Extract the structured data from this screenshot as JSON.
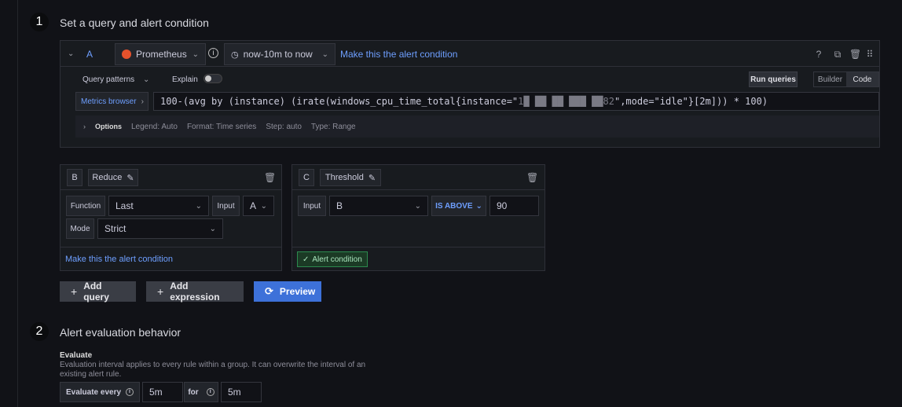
{
  "step1": {
    "number": "1",
    "title": "Set a query and alert condition"
  },
  "query_a": {
    "ref": "A",
    "datasource": "Prometheus",
    "time_range": "now-10m to now",
    "make_condition": "Make this the alert condition",
    "query_patterns": "Query patterns",
    "explain": "Explain",
    "run_queries": "Run queries",
    "mode_builder": "Builder",
    "mode_code": "Code",
    "metrics_browser": "Metrics browser",
    "query_prefix": "100-(avg by (instance) (irate(windows_cpu_time_total{instance=\"",
    "query_redacted": "1█ ██ ██ ███ ██82",
    "query_suffix": "\",mode=\"idle\"}[2m])) * 100)",
    "options_label": "Options",
    "options": [
      "Legend: Auto",
      "Format: Time series",
      "Step: auto",
      "Type: Range"
    ]
  },
  "expr_b": {
    "ref": "B",
    "type": "Reduce",
    "function_label": "Function",
    "function_value": "Last",
    "input_label": "Input",
    "input_value": "A",
    "mode_label": "Mode",
    "mode_value": "Strict",
    "make_condition": "Make this the alert condition"
  },
  "expr_c": {
    "ref": "C",
    "type": "Threshold",
    "input_label": "Input",
    "input_value": "B",
    "operator": "IS ABOVE",
    "threshold": "90",
    "condition_badge": "Alert condition"
  },
  "actions": {
    "add_query": "Add query",
    "add_expression": "Add expression",
    "preview": "Preview"
  },
  "step2": {
    "number": "2",
    "title": "Alert evaluation behavior",
    "evaluate_heading": "Evaluate",
    "evaluate_desc": "Evaluation interval applies to every rule within a group. It can overwrite the interval of an existing alert rule.",
    "evaluate_every_label": "Evaluate every",
    "evaluate_every_value": "5m",
    "for_label": "for",
    "for_value": "5m"
  },
  "colors": {
    "accent": "#3d71d9",
    "link": "#6e9fff",
    "success": "#1a7f4b",
    "prometheus": "#e6522c"
  }
}
